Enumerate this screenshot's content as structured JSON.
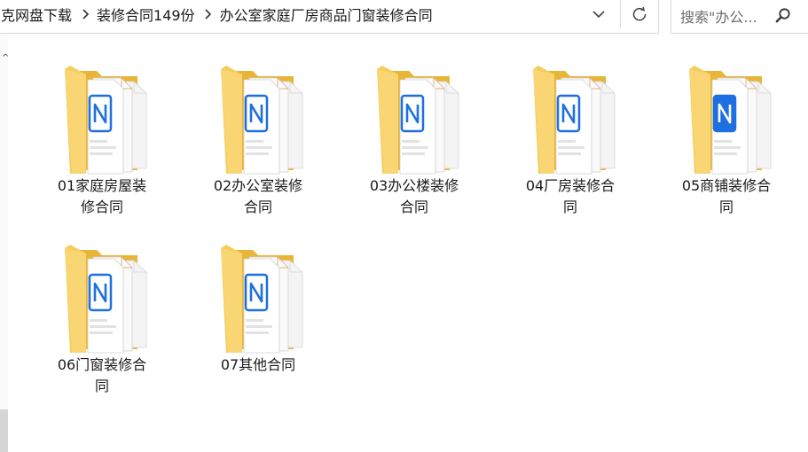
{
  "breadcrumb": {
    "items": [
      "克网盘下载",
      "装修合同149份",
      "办公室家庭厂房商品门窗装修合同"
    ]
  },
  "search": {
    "placeholder": "搜索\"办公..."
  },
  "left_edge_mark": "^",
  "folders": [
    {
      "label": "01家庭房屋装修合同",
      "badge_color": "#ffffff"
    },
    {
      "label": "02办公室装修合同",
      "badge_color": "#ffffff"
    },
    {
      "label": "03办公楼装修合同",
      "badge_color": "#ffffff"
    },
    {
      "label": "04厂房装修合同",
      "badge_color": "#ffffff"
    },
    {
      "label": "05商铺装修合同",
      "badge_color": "#1e6fe0"
    },
    {
      "label": "06门窗装修合同",
      "badge_color": "#ffffff"
    },
    {
      "label": "07其他合同",
      "badge_color": "#ffffff"
    }
  ],
  "icons": {
    "breadcrumb_separator": "chevron-right-icon",
    "dropdown": "chevron-down-icon",
    "refresh": "refresh-icon",
    "search": "search-icon",
    "folder": "folder-icon"
  },
  "colors": {
    "folder_yellow": "#f5c84e",
    "folder_back": "#e8b536",
    "doc_blue": "#1e6fe0"
  }
}
